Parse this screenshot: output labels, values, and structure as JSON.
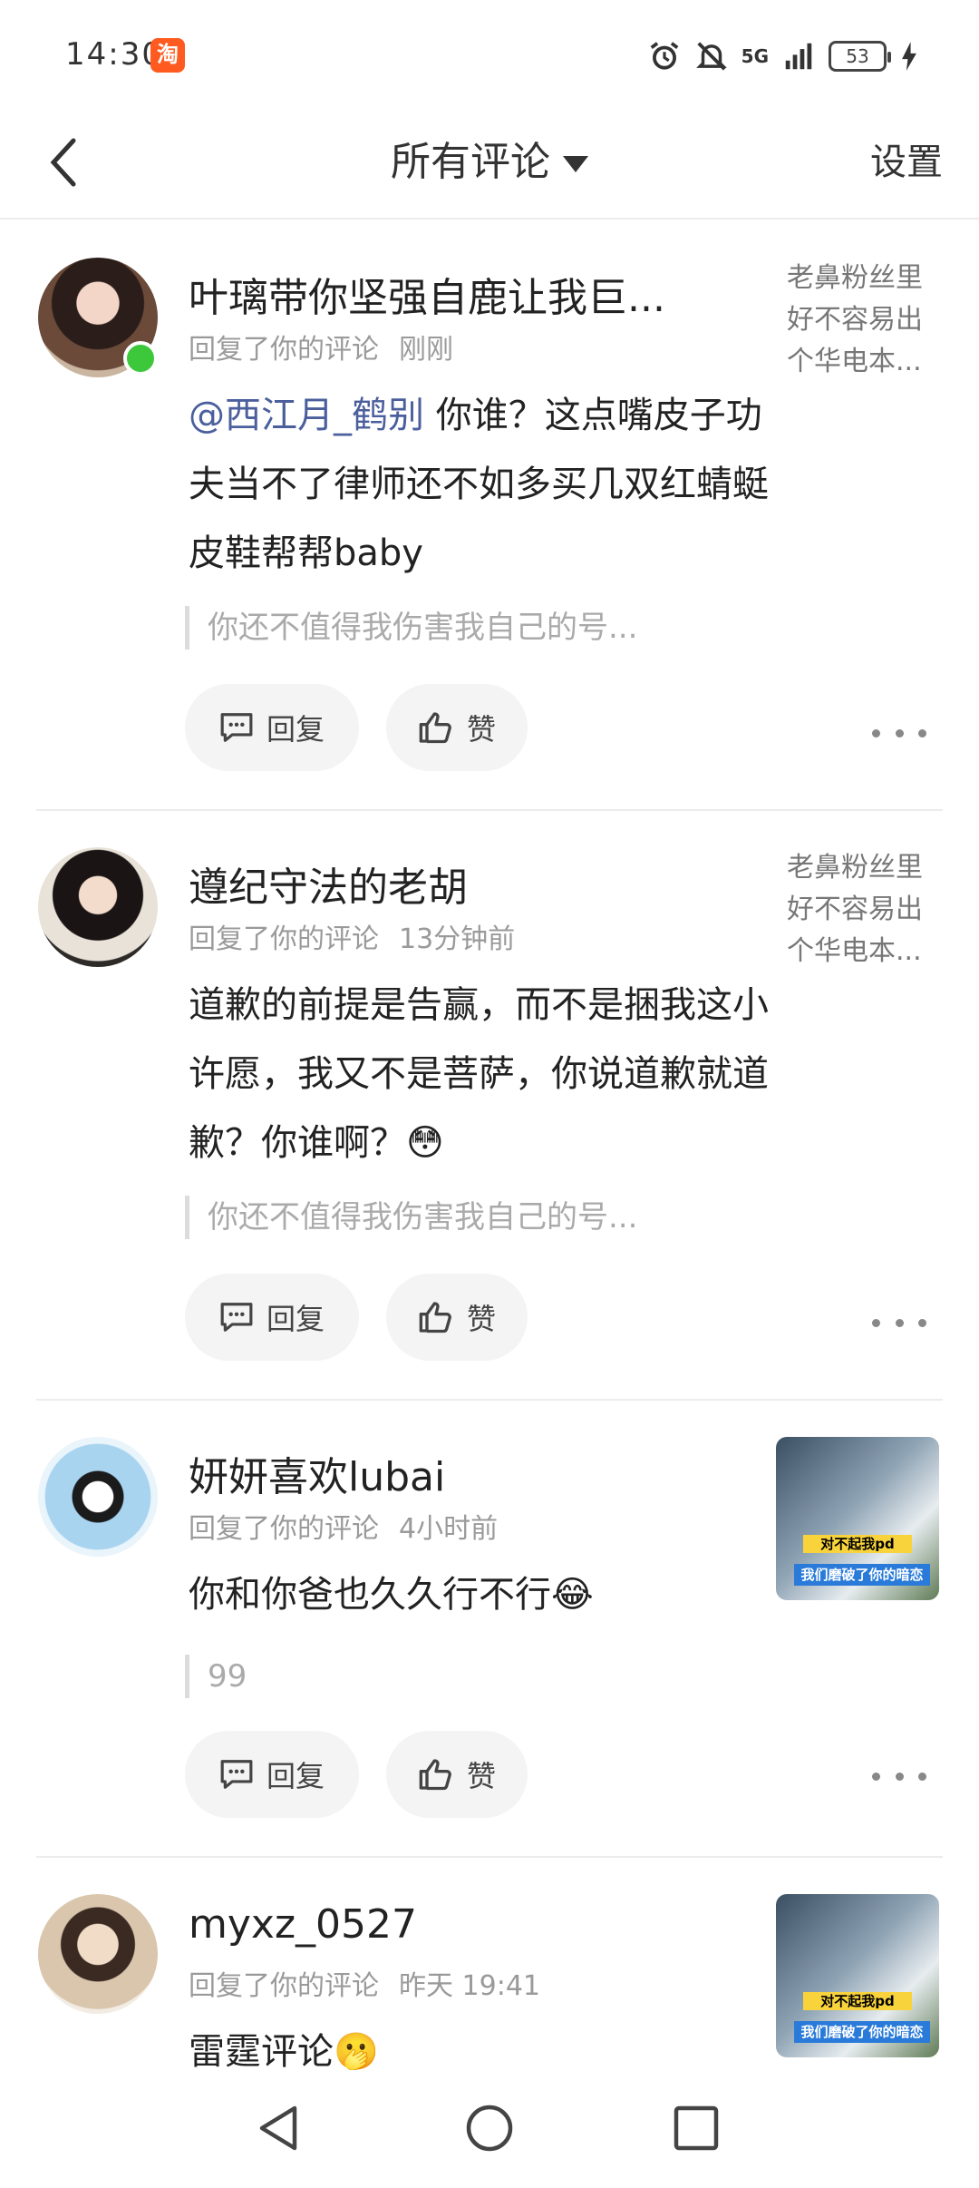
{
  "status_bar": {
    "time": "14:30",
    "app_badge": "淘",
    "network": "5G",
    "battery": "53"
  },
  "header": {
    "title": "所有评论",
    "settings_label": "设置"
  },
  "comments": [
    {
      "username": "叶璃带你坚强自鹿让我巨...",
      "action": "回复了你的评论",
      "time": "刚刚",
      "mention": "@西江月_鹤别",
      "text": " 你谁？这点嘴皮子功夫当不了律师还不如多买几双红蜻蜓皮鞋帮帮baby",
      "quote": "你还不值得我伤害我自己的号...",
      "side_text": "老鼻粉丝里好不容易出个华电本...",
      "online": true,
      "reply_label": "回复",
      "like_label": "赞"
    },
    {
      "username": "遵纪守法的老胡",
      "action": "回复了你的评论",
      "time": "13分钟前",
      "mention": "",
      "text": "道歉的前提是告赢，而不是捆我这小许愿，我又不是菩萨，你说道歉就道歉？你谁啊？😳",
      "quote": "你还不值得我伤害我自己的号...",
      "side_text": "老鼻粉丝里好不容易出个华电本...",
      "online": false,
      "reply_label": "回复",
      "like_label": "赞"
    },
    {
      "username": "妍妍喜欢lubai",
      "action": "回复了你的评论",
      "time": "4小时前",
      "mention": "",
      "text": "你和你爸也久久行不行😂",
      "quote": "99",
      "thumb_line1": "对不起我pd",
      "thumb_line2": "我们磨破了你的暗恋",
      "online": false,
      "reply_label": "回复",
      "like_label": "赞"
    },
    {
      "username": "myxz_0527",
      "action": "回复了你的评论",
      "time": "昨天 19:41",
      "mention": "",
      "text": "雷霆评论🫢",
      "thumb_line1": "对不起我pd",
      "thumb_line2": "我们磨破了你的暗恋",
      "online": false
    }
  ],
  "icons": {
    "back": "chevron-left-icon",
    "reply": "chat-bubble-icon",
    "like": "thumbs-up-icon",
    "more": "more-horizontal-icon",
    "nav_back": "triangle-back-icon",
    "nav_home": "circle-home-icon",
    "nav_recents": "square-recents-icon"
  },
  "colors": {
    "online": "#3cc83a",
    "mention": "#4a5f9c",
    "taobao": "#ff5a1f"
  }
}
